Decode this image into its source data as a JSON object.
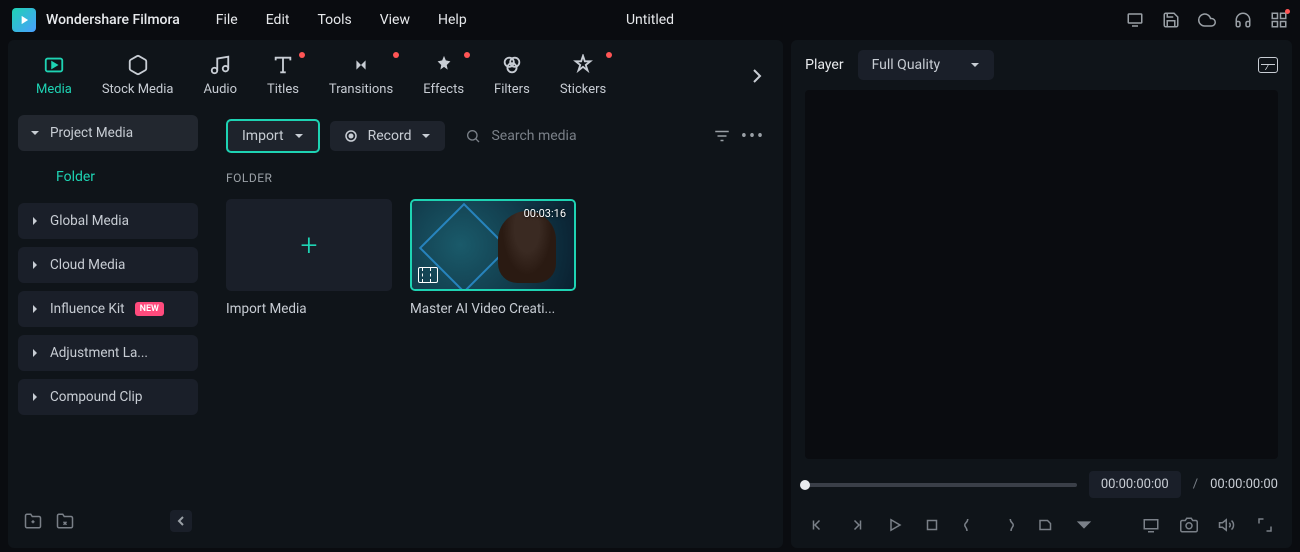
{
  "app": {
    "name": "Wondershare Filmora",
    "project_title": "Untitled"
  },
  "menu": {
    "file": "File",
    "edit": "Edit",
    "tools": "Tools",
    "view": "View",
    "help": "Help"
  },
  "tabs": {
    "media": "Media",
    "stock_media": "Stock Media",
    "audio": "Audio",
    "titles": "Titles",
    "transitions": "Transitions",
    "effects": "Effects",
    "filters": "Filters",
    "stickers": "Stickers"
  },
  "sidebar": {
    "project_media": "Project Media",
    "folder": "Folder",
    "global_media": "Global Media",
    "cloud_media": "Cloud Media",
    "influence_kit": "Influence Kit",
    "influence_badge": "NEW",
    "adjustment_layer": "Adjustment La...",
    "compound_clip": "Compound Clip"
  },
  "toolbar": {
    "import": "Import",
    "record": "Record",
    "search_placeholder": "Search media"
  },
  "content": {
    "section": "FOLDER",
    "import_card": "Import Media",
    "clip": {
      "duration": "00:03:16",
      "title": "Master AI Video Creati..."
    }
  },
  "player": {
    "label": "Player",
    "quality": "Full Quality",
    "current_time": "00:00:00:00",
    "total_time": "00:00:00:00",
    "separator": "/"
  }
}
